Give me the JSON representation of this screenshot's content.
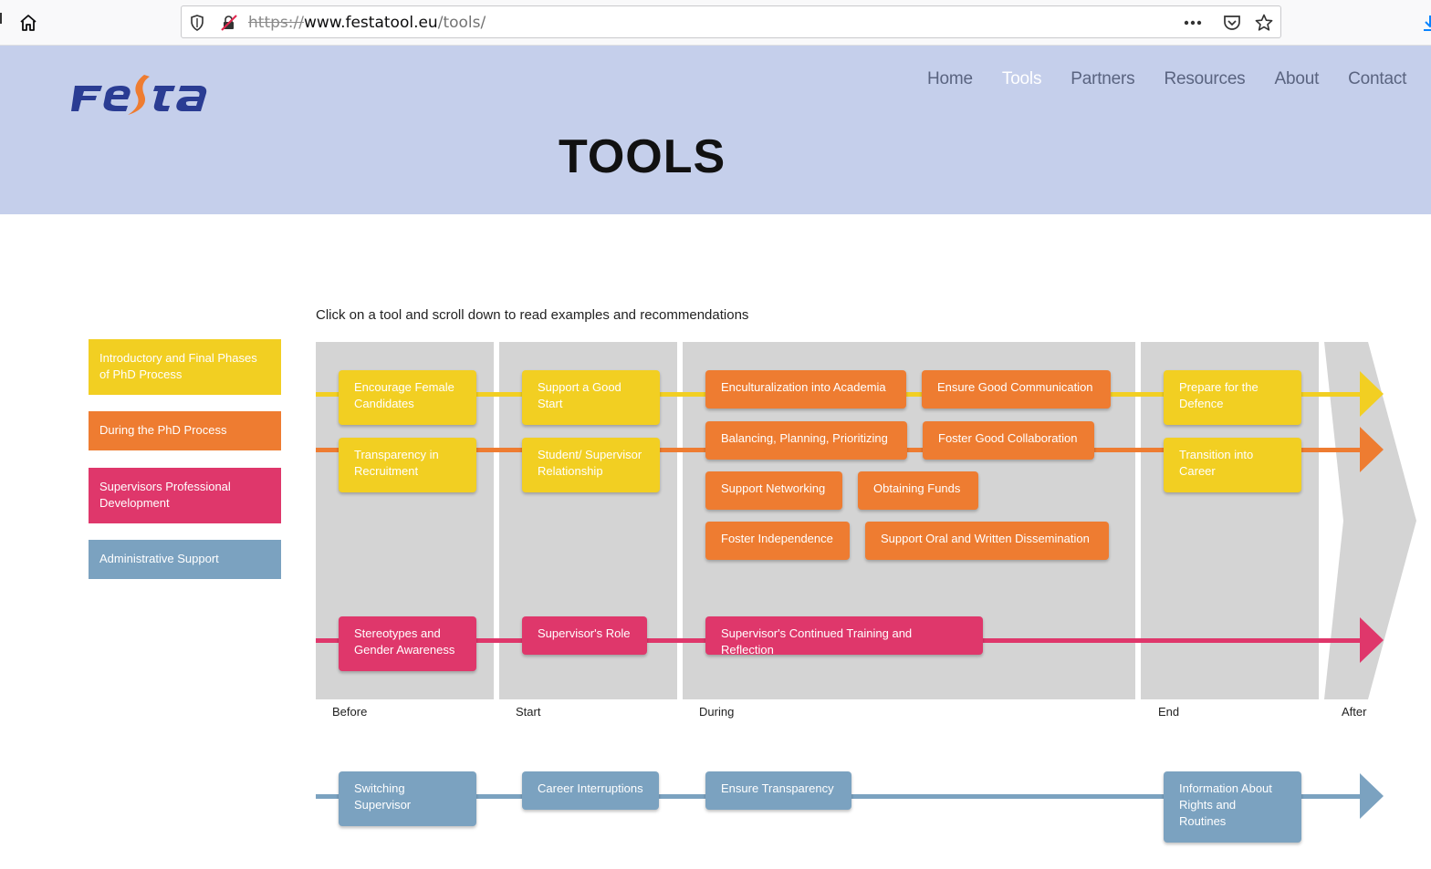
{
  "browser": {
    "url_scheme": "https://",
    "url_host": "www.festatool.eu",
    "url_path": "/tools/"
  },
  "site": {
    "logo_text": "Festa",
    "nav": [
      "Home",
      "Tools",
      "Partners",
      "Resources",
      "About",
      "Contact"
    ],
    "active_nav": "Tools",
    "page_title": "TOOLS"
  },
  "instructions": "Click on a tool and scroll down to read examples and recommendations",
  "legend": [
    {
      "label": "Introductory and Final Phases of PhD Process",
      "color": "#f2cf22"
    },
    {
      "label": "During the PhD Process",
      "color": "#ee7c31"
    },
    {
      "label": "Supervisors Professional Development",
      "color": "#df376b"
    },
    {
      "label": "Administrative Support",
      "color": "#7ba2c0"
    }
  ],
  "phases": [
    "Before",
    "Start",
    "During",
    "End",
    "After"
  ],
  "tools": {
    "encourage_female": "Encourage Female Candidates",
    "support_good_start": "Support a Good Start",
    "enculturalization": "Enculturalization into Academia",
    "ensure_communication": "Ensure Good Communication",
    "prepare_defence": "Prepare for the Defence",
    "transparency_recruitment": "Transparency in Recruitment",
    "student_supervisor": "Student/ Supervisor Relationship",
    "balancing": "Balancing, Planning, Prioritizing",
    "foster_collaboration": "Foster Good Collaboration",
    "transition_career": "Transition into Career",
    "support_networking": "Support Networking",
    "obtaining_funds": "Obtaining Funds",
    "foster_independence": "Foster Independence",
    "oral_written": "Support Oral and Written Dissemination",
    "stereotypes": "Stereotypes and Gender Awareness",
    "supervisors_role": "Supervisor's Role",
    "continued_training": "Supervisor's Continued Training and Reflection",
    "switching_supervisor": "Switching Supervisor",
    "career_interruptions": "Career Interruptions",
    "ensure_transparency": "Ensure Transparency",
    "info_rights": "Information About Rights and Routines"
  },
  "colors": {
    "header_bg": "#c5cfeb",
    "yellow": "#f2cf22",
    "orange": "#ee7c31",
    "pink": "#df376b",
    "blue": "#7ba2c0",
    "phase_bg": "#d4d4d4"
  }
}
